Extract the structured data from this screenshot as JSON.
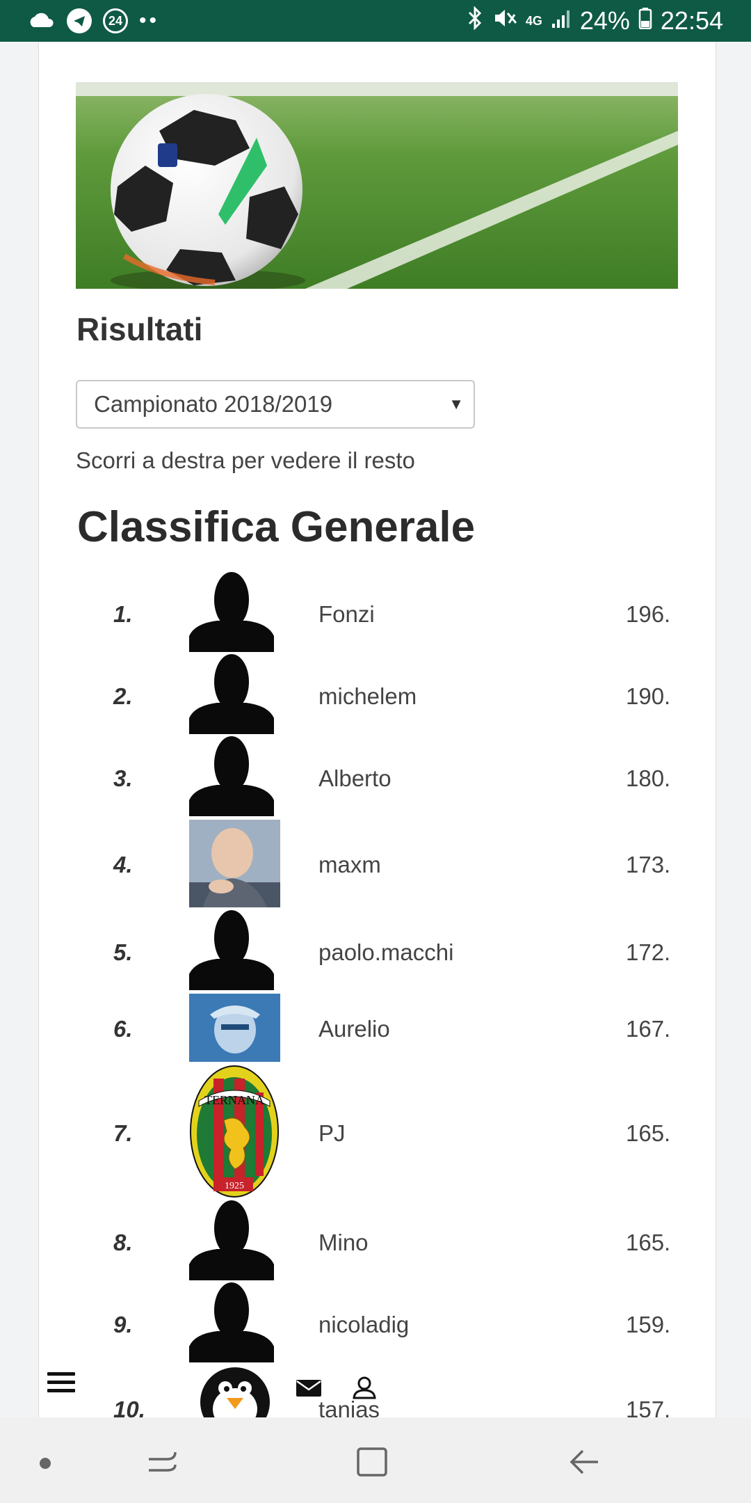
{
  "status_bar": {
    "left_icons": [
      "cloud-icon",
      "telegram-icon",
      "badge-24-icon",
      "dots-icon"
    ],
    "badge_text": "24",
    "battery": "24%",
    "network": "4G",
    "time": "22:54"
  },
  "page": {
    "section_title": "Risultati",
    "season_select": {
      "value": "Campionato 2018/2019"
    },
    "scroll_hint": "Scorri a destra per vedere il resto",
    "table_title": "Classifica Generale"
  },
  "ranking": [
    {
      "rank": "1.",
      "name": "Fonzi",
      "points": "196.",
      "avatar": "silhouette"
    },
    {
      "rank": "2.",
      "name": "michelem",
      "points": "190.",
      "avatar": "silhouette"
    },
    {
      "rank": "3.",
      "name": "Alberto",
      "points": "180.",
      "avatar": "silhouette"
    },
    {
      "rank": "4.",
      "name": "maxm",
      "points": "173.",
      "avatar": "photo"
    },
    {
      "rank": "5.",
      "name": "paolo.macchi",
      "points": "172.",
      "avatar": "silhouette"
    },
    {
      "rank": "6.",
      "name": "Aurelio",
      "points": "167.",
      "avatar": "photo-blue"
    },
    {
      "rank": "7.",
      "name": "PJ",
      "points": "165.",
      "avatar": "ternana-crest",
      "crest_text": "TERNANA",
      "crest_year": "1925"
    },
    {
      "rank": "8.",
      "name": "Mino",
      "points": "165.",
      "avatar": "silhouette"
    },
    {
      "rank": "9.",
      "name": "nicoladig",
      "points": "159.",
      "avatar": "silhouette"
    },
    {
      "rank": "10.",
      "name": "tanias",
      "points": "157.",
      "avatar": "penguin"
    }
  ],
  "bottom_menu": {
    "icons": [
      "menu-icon",
      "mail-icon",
      "user-icon"
    ]
  },
  "colors": {
    "status_bar": "#0e5a45",
    "page_bg": "#ffffff",
    "outer_bg": "#f2f3f4"
  }
}
